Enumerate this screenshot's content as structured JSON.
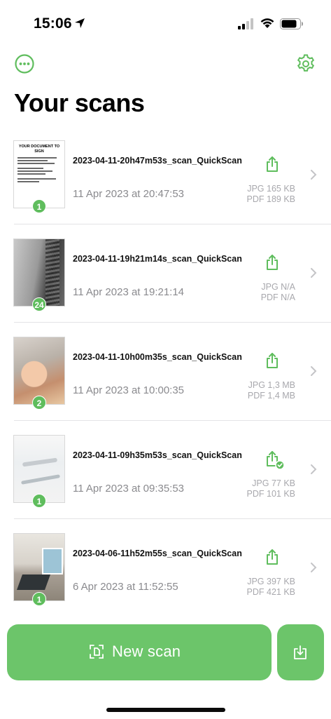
{
  "status_bar": {
    "time": "15:06"
  },
  "header": {
    "title": "Your scans"
  },
  "colors": {
    "accent": "#5fbd5d",
    "button": "#6cc56a",
    "secondary_text": "#8a8a8e"
  },
  "scans": [
    {
      "name": "2023-04-11-20h47m53s_scan_QuickScan",
      "date": "11 Apr 2023 at 20:47:53",
      "pages": "1",
      "jpg": "JPG 165 KB",
      "pdf": "PDF 189 KB",
      "shared": false,
      "doc": {
        "title": "YOUR DOCUMENT TO SIGN"
      }
    },
    {
      "name": "2023-04-11-19h21m14s_scan_QuickScan",
      "date": "11 Apr 2023 at 19:21:14",
      "pages": "24",
      "jpg": "JPG N/A",
      "pdf": "PDF N/A",
      "shared": false
    },
    {
      "name": "2023-04-11-10h00m35s_scan_QuickScan",
      "date": "11 Apr 2023 at 10:00:35",
      "pages": "2",
      "jpg": "JPG 1,3 MB",
      "pdf": "PDF 1,4 MB",
      "shared": false
    },
    {
      "name": "2023-04-11-09h35m53s_scan_QuickScan",
      "date": "11 Apr 2023 at 09:35:53",
      "pages": "1",
      "jpg": "JPG 77 KB",
      "pdf": "PDF 101 KB",
      "shared": true
    },
    {
      "name": "2023-04-06-11h52m55s_scan_QuickScan",
      "date": "6 Apr 2023 at 11:52:55",
      "pages": "1",
      "jpg": "JPG 397 KB",
      "pdf": "PDF 421 KB",
      "shared": false
    }
  ],
  "actions": {
    "new_scan_label": "New scan",
    "new_scan_icon": "scan-frame-icon",
    "import_icon": "tray-download-icon"
  }
}
